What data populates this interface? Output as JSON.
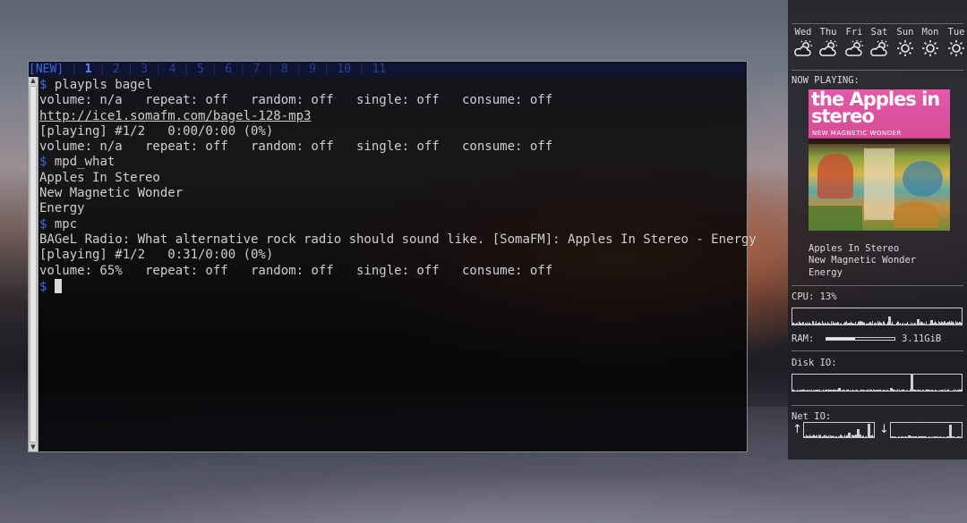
{
  "tabs": [
    {
      "label": "[NEW]",
      "kind": "new"
    },
    {
      "label": "1",
      "kind": "active"
    },
    {
      "label": "2",
      "kind": "normal"
    },
    {
      "label": "3",
      "kind": "normal"
    },
    {
      "label": "4",
      "kind": "normal"
    },
    {
      "label": "5",
      "kind": "normal"
    },
    {
      "label": "6",
      "kind": "normal"
    },
    {
      "label": "7",
      "kind": "normal"
    },
    {
      "label": "8",
      "kind": "normal"
    },
    {
      "label": "9",
      "kind": "normal"
    },
    {
      "label": "10",
      "kind": "normal"
    },
    {
      "label": "11",
      "kind": "normal"
    }
  ],
  "terminal": {
    "lines": [
      {
        "type": "cmd",
        "prompt": "$",
        "text": "playpls bagel"
      },
      {
        "type": "out",
        "text": "volume: n/a   repeat: off   random: off   single: off   consume: off"
      },
      {
        "type": "url",
        "text": "http://ice1.somafm.com/bagel-128-mp3"
      },
      {
        "type": "out",
        "text": "[playing] #1/2   0:00/0:00 (0%)"
      },
      {
        "type": "out",
        "text": "volume: n/a   repeat: off   random: off   single: off   consume: off"
      },
      {
        "type": "cmd",
        "prompt": "$",
        "text": "mpd_what"
      },
      {
        "type": "out",
        "text": "Apples In Stereo"
      },
      {
        "type": "out",
        "text": "New Magnetic Wonder"
      },
      {
        "type": "out",
        "text": "Energy"
      },
      {
        "type": "cmd",
        "prompt": "$",
        "text": "mpc"
      },
      {
        "type": "out",
        "text": "BAGeL Radio: What alternative rock radio should sound like. [SomaFM]: Apples In Stereo - Energy"
      },
      {
        "type": "out",
        "text": "[playing] #1/2   0:31/0:00 (0%)"
      },
      {
        "type": "out",
        "text": "volume: 65%   repeat: off   random: off   single: off   consume: off"
      },
      {
        "type": "input",
        "prompt": "$",
        "text": ""
      }
    ]
  },
  "panel": {
    "weather": [
      {
        "day": "Wed",
        "icon": "partly-cloudy-icon"
      },
      {
        "day": "Thu",
        "icon": "partly-cloudy-icon"
      },
      {
        "day": "Fri",
        "icon": "partly-cloudy-icon"
      },
      {
        "day": "Sat",
        "icon": "partly-cloudy-icon"
      },
      {
        "day": "Sun",
        "icon": "sunny-icon"
      },
      {
        "day": "Mon",
        "icon": "sunny-icon"
      },
      {
        "day": "Tue",
        "icon": "sunny-icon"
      }
    ],
    "now_playing_label": "NOW PLAYING:",
    "album_art": {
      "title_text": "the Apples in stereo",
      "subtitle_text": "NEW MAGNETIC WONDER"
    },
    "artist": "Apples In Stereo",
    "album": "New Magnetic Wonder",
    "track": "Energy",
    "cpu_label": "CPU: 13%",
    "ram_label": "RAM:",
    "ram_value": "3.11GiB",
    "ram_fraction": 0.42,
    "disk_label": "Disk IO:",
    "net_label": "Net IO:",
    "up_arrow": "↑",
    "down_arrow": "↓"
  },
  "colors": {
    "prompt": "#3f68e0",
    "terminal_text": "#cfcfcf",
    "panel_text": "#dcdcdc",
    "tab_active": "#5a86ff"
  }
}
